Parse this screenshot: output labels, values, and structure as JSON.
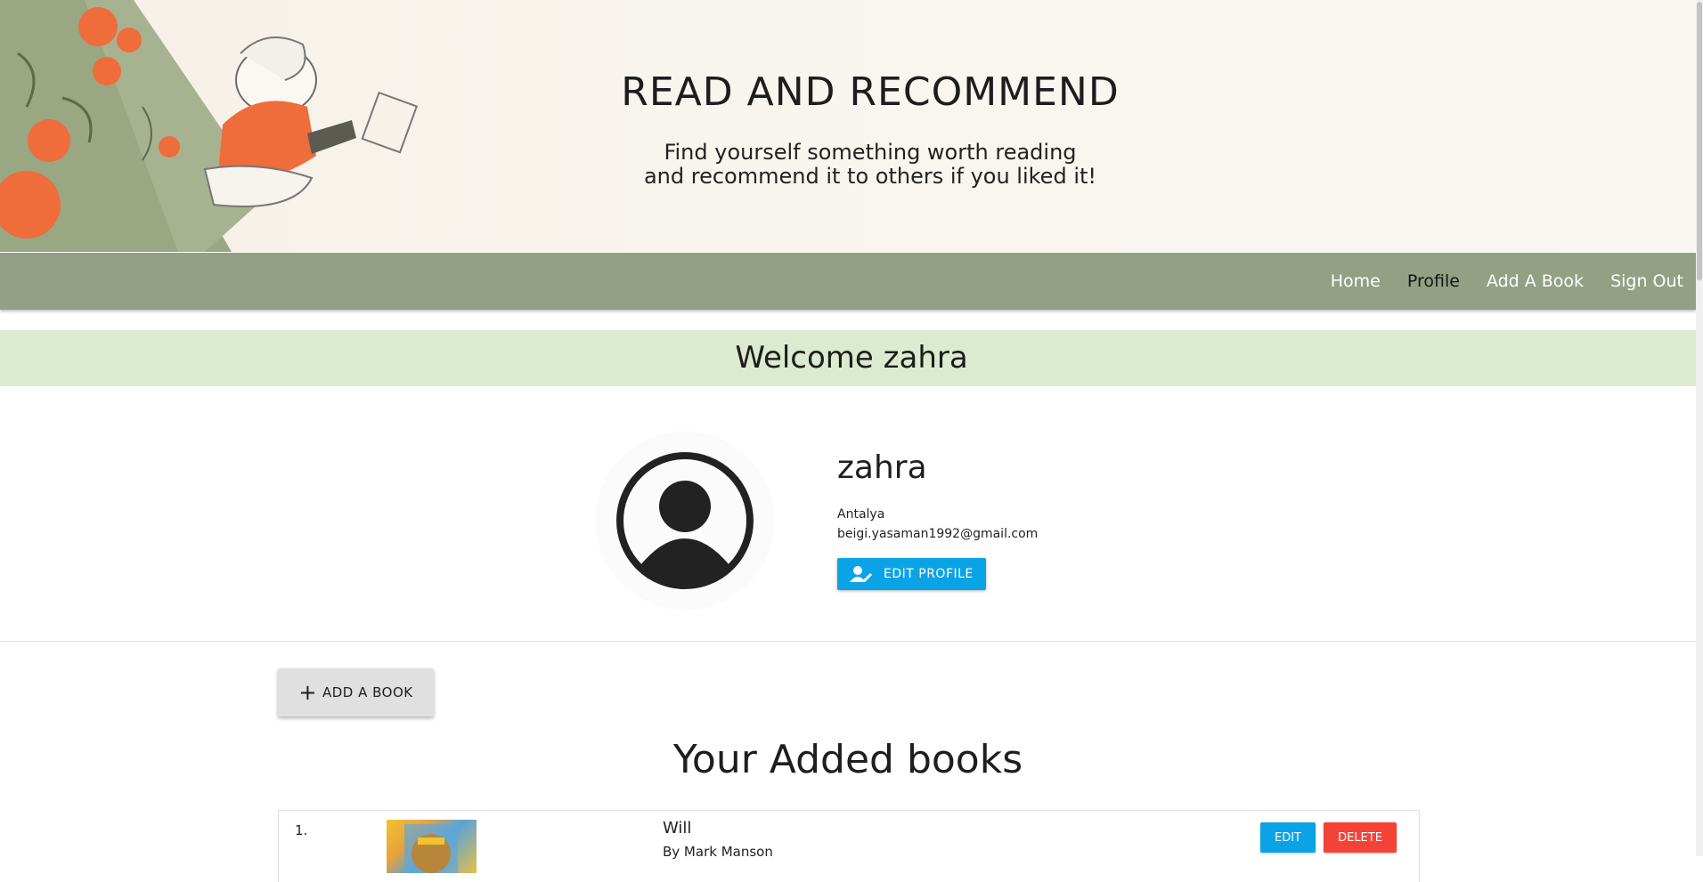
{
  "header": {
    "title": "READ AND RECOMMEND",
    "subtitle_line1": "Find yourself something worth reading",
    "subtitle_line2": "and recommend it to others if you liked it!"
  },
  "nav": {
    "items": [
      {
        "label": "Home",
        "active": false
      },
      {
        "label": "Profile",
        "active": true
      },
      {
        "label": "Add A Book",
        "active": false
      },
      {
        "label": "Sign Out",
        "active": false
      }
    ]
  },
  "welcome": {
    "text": "Welcome zahra"
  },
  "profile": {
    "name": "zahra",
    "city": "Antalya",
    "email": "beigi.yasaman1992@gmail.com",
    "edit_label": "EDIT PROFILE"
  },
  "books_section": {
    "add_label": "ADD A BOOK",
    "title": "Your Added books",
    "books": [
      {
        "index": "1.",
        "title": "Will",
        "author": "By Mark Manson",
        "edit_label": "EDIT",
        "delete_label": "DELETE"
      }
    ]
  },
  "colors": {
    "navbar": "#93a084",
    "welcome_bg": "#dcebcf",
    "primary_button": "#0aa4e6",
    "danger_button": "#f44336"
  }
}
